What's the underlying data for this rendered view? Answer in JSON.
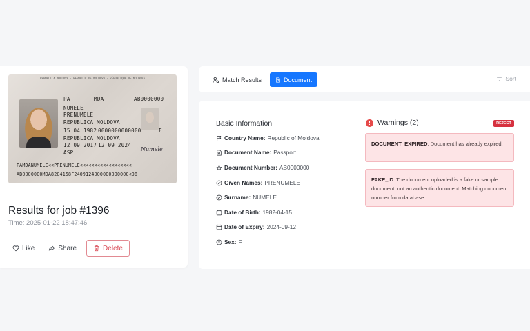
{
  "passport": {
    "header": "REPUBLICA MOLDOVA · REPUBLIC OF MOLDOVA · RÉPUBLIQUE DE MOLDOVA",
    "type": "PA",
    "code": "MDA",
    "number": "AB0000000",
    "surname": "NUMELE",
    "given_names": "PRENUMELE",
    "nationality": "REPUBLICA MOLDOVA",
    "birth_date": "15 04 1982",
    "personal_no": "0000000000000",
    "sex": "F",
    "issue_date": "12 09 2017",
    "expiry_date": "12 09 2024",
    "authority": "ASP",
    "signature": "Numele",
    "mrz_line1": "PAMDANUMELE<<PRENUMELE<<<<<<<<<<<<<<<<<<",
    "mrz_line2": "AB0000000MDA8204158F2409124000000000000<08"
  },
  "job": {
    "title": "Results for job #1396",
    "time": "Time: 2025-01-22 18:47:46"
  },
  "actions": {
    "like": "Like",
    "share": "Share",
    "delete": "Delete"
  },
  "tabs": {
    "match": "Match Results",
    "document": "Document",
    "sort": "Sort"
  },
  "basic": {
    "title": "Basic Information",
    "fields": [
      {
        "label": "Country Name:",
        "value": "Republic of Moldova"
      },
      {
        "label": "Document Name:",
        "value": "Passport"
      },
      {
        "label": "Document Number:",
        "value": "AB0000000"
      },
      {
        "label": "Given Names:",
        "value": "PRENUMELE"
      },
      {
        "label": "Surname:",
        "value": "NUMELE"
      },
      {
        "label": "Date of Birth:",
        "value": "1982-04-15"
      },
      {
        "label": "Date of Expiry:",
        "value": "2024-09-12"
      },
      {
        "label": "Sex:",
        "value": "F"
      }
    ]
  },
  "warnings": {
    "title": "Warnings (2)",
    "badge": "REJECT",
    "items": [
      {
        "code": "DOCUMENT_EXPIRED",
        "text": ": Document has already expired."
      },
      {
        "code": "FAKE_ID",
        "text": ": The document uploaded is a fake or sample document, not an authentic document. Matching document number from database."
      }
    ]
  },
  "colors": {
    "accent": "#1677ff",
    "danger": "#d6313f",
    "warning_bg": "#fde4e6"
  }
}
